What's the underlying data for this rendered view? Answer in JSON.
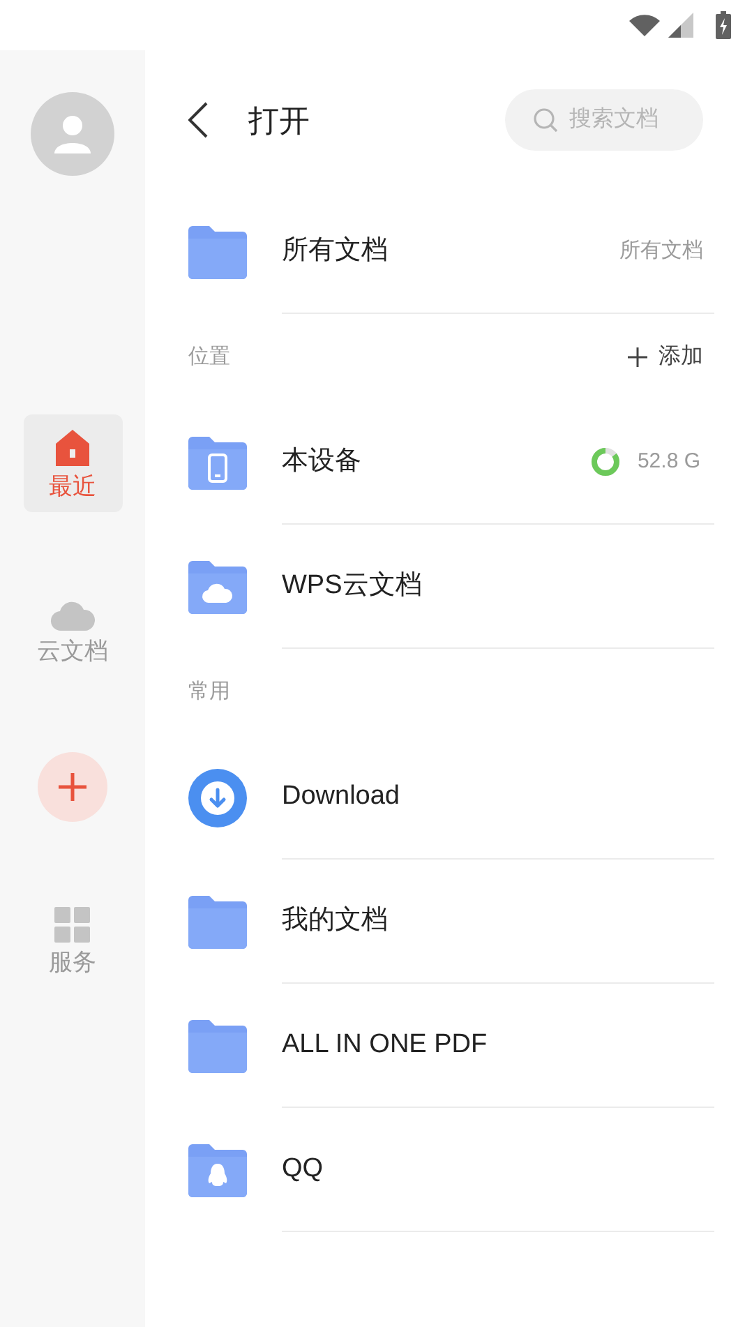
{
  "sidebar": {
    "items": [
      {
        "label": "最近",
        "kind": "home",
        "selected": true
      },
      {
        "label": "云文档",
        "kind": "cloud",
        "selected": false
      },
      {
        "label": "服务",
        "kind": "grid",
        "selected": false
      }
    ]
  },
  "header": {
    "title": "打开",
    "search": {
      "placeholder": "搜索文档"
    }
  },
  "top_item": {
    "label": "所有文档",
    "kind": "folder",
    "aside": "所有文档"
  },
  "sections": [
    {
      "title": "位置",
      "action": "添加",
      "items": [
        {
          "label": "本设备",
          "kind": "device",
          "storage": {
            "reading": "52.8 G"
          }
        },
        {
          "label": "WPS云文档",
          "kind": "cloud"
        }
      ]
    },
    {
      "title": "常用",
      "items": [
        {
          "label": "Download",
          "kind": "download"
        },
        {
          "label": "我的文档",
          "kind": "folder"
        },
        {
          "label": "ALL IN ONE PDF",
          "kind": "folder"
        },
        {
          "label": "QQ",
          "kind": "penguin"
        }
      ]
    }
  ]
}
